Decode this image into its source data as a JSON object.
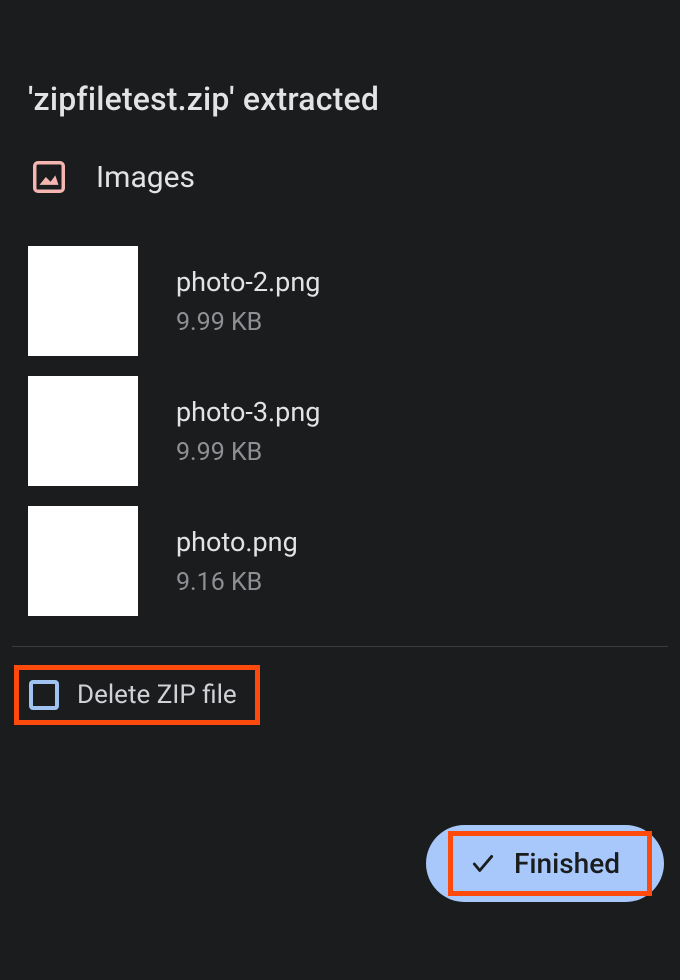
{
  "title": "'zipfiletest.zip' extracted",
  "section": {
    "label": "Images",
    "icon": "image-icon"
  },
  "files": [
    {
      "name": "photo-2.png",
      "size": "9.99 KB"
    },
    {
      "name": "photo-3.png",
      "size": "9.99 KB"
    },
    {
      "name": "photo.png",
      "size": "9.16 KB"
    }
  ],
  "delete_checkbox": {
    "label": "Delete ZIP file",
    "checked": false
  },
  "finished_button": {
    "label": "Finished",
    "icon": "checkmark-icon"
  },
  "colors": {
    "accent": "#a8c7fa",
    "highlight": "#ff4a0d",
    "checkbox_border": "#a0c2f0",
    "icon_tint": "#f5b5b0"
  }
}
